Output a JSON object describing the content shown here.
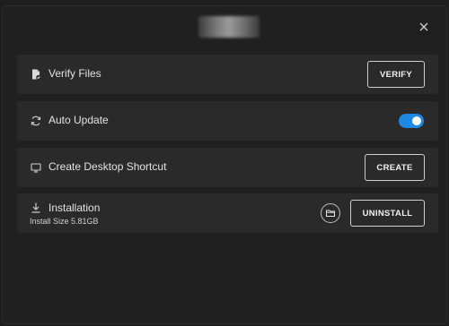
{
  "dialog": {
    "close_label": "×"
  },
  "rows": {
    "verify": {
      "label": "Verify Files",
      "button": "VERIFY",
      "icon": "verify-file-icon"
    },
    "auto_update": {
      "label": "Auto Update",
      "toggle_on": true,
      "icon": "refresh-icon",
      "accent": "#1e88e5"
    },
    "shortcut": {
      "label": "Create Desktop Shortcut",
      "button": "CREATE",
      "icon": "monitor-icon"
    },
    "installation": {
      "label": "Installation",
      "size_text": "Install Size 5.81GB",
      "button": "UNINSTALL",
      "icon": "download-icon",
      "folder_icon": "folder-icon"
    }
  }
}
